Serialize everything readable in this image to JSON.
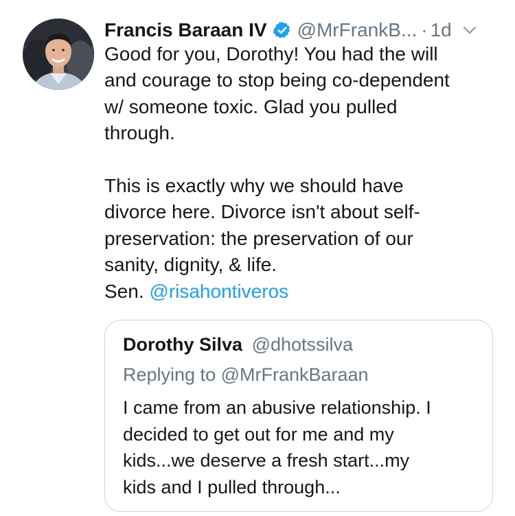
{
  "tweet": {
    "display_name": "Francis Baraan IV",
    "handle": "@MrFrankB...",
    "separator": "·",
    "time": "1d",
    "body_lines_p1": [
      "Good for you, Dorothy! You had the will",
      "and courage to stop being co-dependent",
      "w/ someone toxic. Glad you pulled",
      "through."
    ],
    "body_lines_p2": [
      "This is exactly why we should have",
      "divorce here. Divorce isn't about self-",
      "preservation: the preservation of our",
      "sanity, dignity, & life."
    ],
    "sen_prefix": "Sen. ",
    "sen_mention": "@risahontiveros"
  },
  "quote": {
    "display_name": "Dorothy Silva",
    "handle": "@dhotssilva",
    "replying_prefix": "Replying to ",
    "replying_handle": "@MrFrankBaraan",
    "text_lines": [
      "I came from an abusive relationship. I",
      "decided to get out for me and my",
      "kids...we deserve a fresh start...my",
      "kids and I pulled through..."
    ]
  },
  "colors": {
    "text": "#14171a",
    "secondary": "#657786",
    "link": "#1da1f2",
    "border": "#ccd6dd",
    "verified": "#1da1f2"
  },
  "icons": {
    "verified": "verified-badge-icon",
    "more": "chevron-down-icon"
  }
}
